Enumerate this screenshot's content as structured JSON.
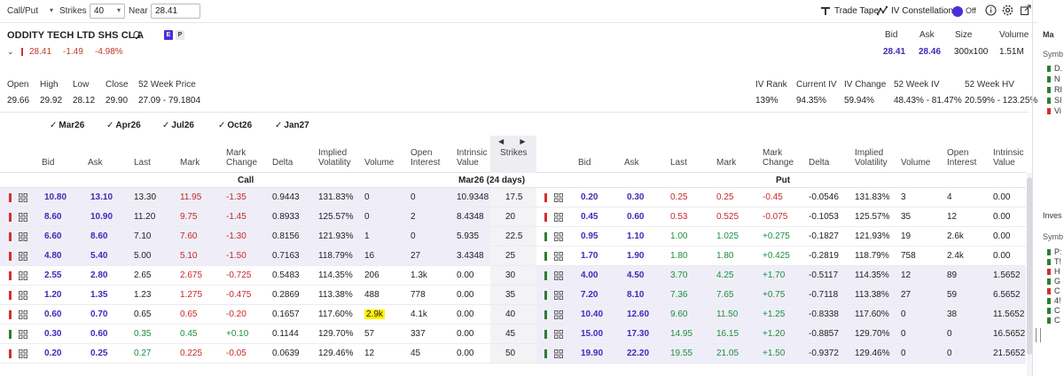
{
  "toolbar": {
    "callput": "Call/Put",
    "strikes_label": "Strikes",
    "strikes_value": "40",
    "near_label": "Near",
    "near_value": "28.41",
    "trade_tape": "Trade Tape",
    "iv_constellation": "IV Constellation",
    "toggle_state": "Off"
  },
  "symbol": {
    "name": "ODDITY TECH LTD SHS CL A",
    "badge_e": "E",
    "badge_p": "P",
    "last": "28.41",
    "change": "-1.49",
    "change_pct": "-4.98%"
  },
  "quote": {
    "bid_label": "Bid",
    "bid": "28.41",
    "ask_label": "Ask",
    "ask": "28.46",
    "size_label": "Size",
    "size": "300x100",
    "volume_label": "Volume",
    "volume": "1.51M"
  },
  "stats": {
    "open_label": "Open",
    "open": "29.66",
    "high_label": "High",
    "high": "29.92",
    "low_label": "Low",
    "low": "28.12",
    "close_label": "Close",
    "close": "29.90",
    "week52_label": "52 Week Price",
    "week52": "27.09 - 79.1804",
    "ivrank_label": "IV Rank",
    "ivrank": "139%",
    "currentiv_label": "Current IV",
    "currentiv": "94.35%",
    "ivchange_label": "IV Change",
    "ivchange": "59.94%",
    "week52iv_label": "52 Week IV",
    "week52iv": "48.43% - 81.47%",
    "week52hv_label": "52 Week HV",
    "week52hv": "20.59% - 123.25%"
  },
  "expirations": [
    "Mar26",
    "Apr26",
    "Jul26",
    "Oct26",
    "Jan27"
  ],
  "chain_header": {
    "bid": "Bid",
    "ask": "Ask",
    "last": "Last",
    "mark": "Mark",
    "mark_change_1": "Mark",
    "mark_change_2": "Change",
    "delta": "Delta",
    "iv_1": "Implied",
    "iv_2": "Volatility",
    "volume": "Volume",
    "oi_1": "Open",
    "oi_2": "Interest",
    "intrinsic_1": "Intrinsic",
    "intrinsic_2": "Value",
    "strikes": "Strikes"
  },
  "section": {
    "call": "Call",
    "expiry": "Mar26 (24 days)",
    "put": "Put"
  },
  "rows": [
    {
      "call": {
        "bid": "10.80",
        "ask": "13.10",
        "last": "13.30",
        "mark": "11.95",
        "mchg": "-1.35",
        "delta": "0.9443",
        "iv": "131.83%",
        "vol": "0",
        "oi": "0",
        "intr": "10.9348"
      },
      "strike": "17.5",
      "put": {
        "bid": "0.20",
        "ask": "0.30",
        "last": "0.25",
        "mark": "0.25",
        "mchg": "-0.45",
        "delta": "-0.0546",
        "iv": "131.83%",
        "vol": "3",
        "oi": "4",
        "intr": "0.00"
      }
    },
    {
      "call": {
        "bid": "8.60",
        "ask": "10.90",
        "last": "11.20",
        "mark": "9.75",
        "mchg": "-1.45",
        "delta": "0.8933",
        "iv": "125.57%",
        "vol": "0",
        "oi": "2",
        "intr": "8.4348"
      },
      "strike": "20",
      "put": {
        "bid": "0.45",
        "ask": "0.60",
        "last": "0.53",
        "mark": "0.525",
        "mchg": "-0.075",
        "delta": "-0.1053",
        "iv": "125.57%",
        "vol": "35",
        "oi": "12",
        "intr": "0.00"
      }
    },
    {
      "call": {
        "bid": "6.60",
        "ask": "8.60",
        "last": "7.10",
        "mark": "7.60",
        "mchg": "-1.30",
        "delta": "0.8156",
        "iv": "121.93%",
        "vol": "1",
        "oi": "0",
        "intr": "5.935"
      },
      "strike": "22.5",
      "put": {
        "bid": "0.95",
        "ask": "1.10",
        "last": "1.00",
        "mark": "1.025",
        "mchg": "+0.275",
        "delta": "-0.1827",
        "iv": "121.93%",
        "vol": "19",
        "oi": "2.6k",
        "intr": "0.00"
      }
    },
    {
      "call": {
        "bid": "4.80",
        "ask": "5.40",
        "last": "5.00",
        "mark": "5.10",
        "mchg": "-1.50",
        "delta": "0.7163",
        "iv": "118.79%",
        "vol": "16",
        "oi": "27",
        "intr": "3.4348"
      },
      "strike": "25",
      "put": {
        "bid": "1.70",
        "ask": "1.90",
        "last": "1.80",
        "mark": "1.80",
        "mchg": "+0.425",
        "delta": "-0.2819",
        "iv": "118.79%",
        "vol": "758",
        "oi": "2.4k",
        "intr": "0.00"
      }
    },
    {
      "call": {
        "bid": "2.55",
        "ask": "2.80",
        "last": "2.65",
        "mark": "2.675",
        "mchg": "-0.725",
        "delta": "0.5483",
        "iv": "114.35%",
        "vol": "206",
        "oi": "1.3k",
        "intr": "0.00"
      },
      "strike": "30",
      "put": {
        "bid": "4.00",
        "ask": "4.50",
        "last": "3.70",
        "mark": "4.25",
        "mchg": "+1.70",
        "delta": "-0.5117",
        "iv": "114.35%",
        "vol": "12",
        "oi": "89",
        "intr": "1.5652"
      }
    },
    {
      "call": {
        "bid": "1.20",
        "ask": "1.35",
        "last": "1.23",
        "mark": "1.275",
        "mchg": "-0.475",
        "delta": "0.2869",
        "iv": "113.38%",
        "vol": "488",
        "oi": "778",
        "intr": "0.00"
      },
      "strike": "35",
      "put": {
        "bid": "7.20",
        "ask": "8.10",
        "last": "7.36",
        "mark": "7.65",
        "mchg": "+0.75",
        "delta": "-0.7118",
        "iv": "113.38%",
        "vol": "27",
        "oi": "59",
        "intr": "6.5652"
      }
    },
    {
      "call": {
        "bid": "0.60",
        "ask": "0.70",
        "last": "0.65",
        "mark": "0.65",
        "mchg": "-0.20",
        "delta": "0.1657",
        "iv": "117.60%",
        "vol": "2.9k",
        "oi": "4.1k",
        "intr": "0.00"
      },
      "strike": "40",
      "put": {
        "bid": "10.40",
        "ask": "12.60",
        "last": "9.60",
        "mark": "11.50",
        "mchg": "+1.25",
        "delta": "-0.8338",
        "iv": "117.60%",
        "vol": "0",
        "oi": "38",
        "intr": "11.5652"
      }
    },
    {
      "call": {
        "bid": "0.30",
        "ask": "0.60",
        "last": "0.35",
        "mark": "0.45",
        "mchg": "+0.10",
        "delta": "0.1144",
        "iv": "129.70%",
        "vol": "57",
        "oi": "337",
        "intr": "0.00"
      },
      "strike": "45",
      "put": {
        "bid": "15.00",
        "ask": "17.30",
        "last": "14.95",
        "mark": "16.15",
        "mchg": "+1.20",
        "delta": "-0.8857",
        "iv": "129.70%",
        "vol": "0",
        "oi": "0",
        "intr": "16.5652"
      }
    },
    {
      "call": {
        "bid": "0.20",
        "ask": "0.25",
        "last": "0.27",
        "mark": "0.225",
        "mchg": "-0.05",
        "delta": "0.0639",
        "iv": "129.46%",
        "vol": "12",
        "oi": "45",
        "intr": "0.00"
      },
      "strike": "50",
      "put": {
        "bid": "19.90",
        "ask": "22.20",
        "last": "19.55",
        "mark": "21.05",
        "mchg": "+1.50",
        "delta": "-0.9372",
        "iv": "129.46%",
        "vol": "0",
        "oi": "0",
        "intr": "21.5652"
      }
    }
  ],
  "side": {
    "title": "Ma",
    "symbol_label": "Symb",
    "items": [
      "D.",
      "N",
      "RI",
      "SI",
      "Vi"
    ],
    "investing": "Inves",
    "symbol_label2": "Symb",
    "items2": [
      "P:",
      "T!",
      "H",
      "G",
      "C",
      "4!",
      "C",
      "C"
    ]
  },
  "colors": {
    "accent": "#3f2ab8",
    "negative": "#c62828",
    "positive": "#1e8e3e",
    "itm_background": "#efeef8"
  }
}
